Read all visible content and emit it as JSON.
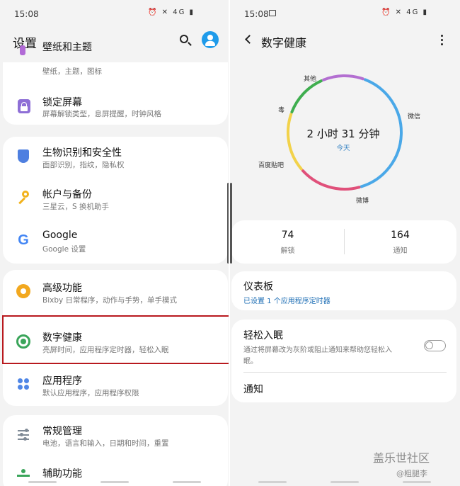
{
  "left": {
    "status_time": "15:08",
    "status_icons": "⏰ ✕ 4G ▮",
    "header_title": "设置",
    "items": [
      {
        "title": "壁纸和主题",
        "sub": "壁纸，主题，图标"
      },
      {
        "title": "锁定屏幕",
        "sub": "屏幕解锁类型，息屏提醒，时钟风格"
      },
      {
        "title": "生物识别和安全性",
        "sub": "面部识别，指纹，隐私权"
      },
      {
        "title": "帐户与备份",
        "sub": "三星云，S 换机助手"
      },
      {
        "title": "Google",
        "sub": "Google 设置"
      },
      {
        "title": "高级功能",
        "sub": "Bixby 日常程序，动作与手势，单手模式"
      },
      {
        "title": "数字健康",
        "sub": "亮屏时间，应用程序定时器，轻松入眠"
      },
      {
        "title": "应用程序",
        "sub": "默认应用程序，应用程序权限"
      },
      {
        "title": "常规管理",
        "sub": "电池，语言和输入，日期和时间，重置"
      },
      {
        "title": "辅助功能",
        "sub": ""
      }
    ],
    "google_glyph": "G"
  },
  "right": {
    "status_time": "15:08",
    "status_icons": "⏰ ✕ 4G ▮",
    "header_title": "数字健康",
    "ring": {
      "total": "2 小时 31 分钟",
      "period": "今天",
      "segments": [
        {
          "name": "微信",
          "color": "#4aa8e8",
          "fraction": 0.4
        },
        {
          "name": "微博",
          "color": "#e0507a",
          "fraction": 0.18
        },
        {
          "name": "百度贴吧",
          "color": "#f2d24a",
          "fraction": 0.17
        },
        {
          "name": "毒",
          "color": "#3fae4f",
          "fraction": 0.13
        },
        {
          "name": "其他",
          "color": "#b36fd1",
          "fraction": 0.12
        }
      ]
    },
    "stats": {
      "unlocks_value": "74",
      "unlocks_label": "解锁",
      "notifications_value": "164",
      "notifications_label": "通知"
    },
    "dashboard": {
      "title": "仪表板",
      "sub": "已设置 1 个应用程序定时器",
      "sub_color": "#1f6fb5"
    },
    "wind_down": {
      "title": "轻松入眠",
      "sub_line1": "通过将屏幕改为灰阶或阻止通知来帮助您轻松入",
      "sub_line2": "眠。",
      "enabled": false
    },
    "notifications_item": "通知"
  },
  "watermark": {
    "main": "盖乐世社区",
    "sub": "@粗腿李"
  }
}
